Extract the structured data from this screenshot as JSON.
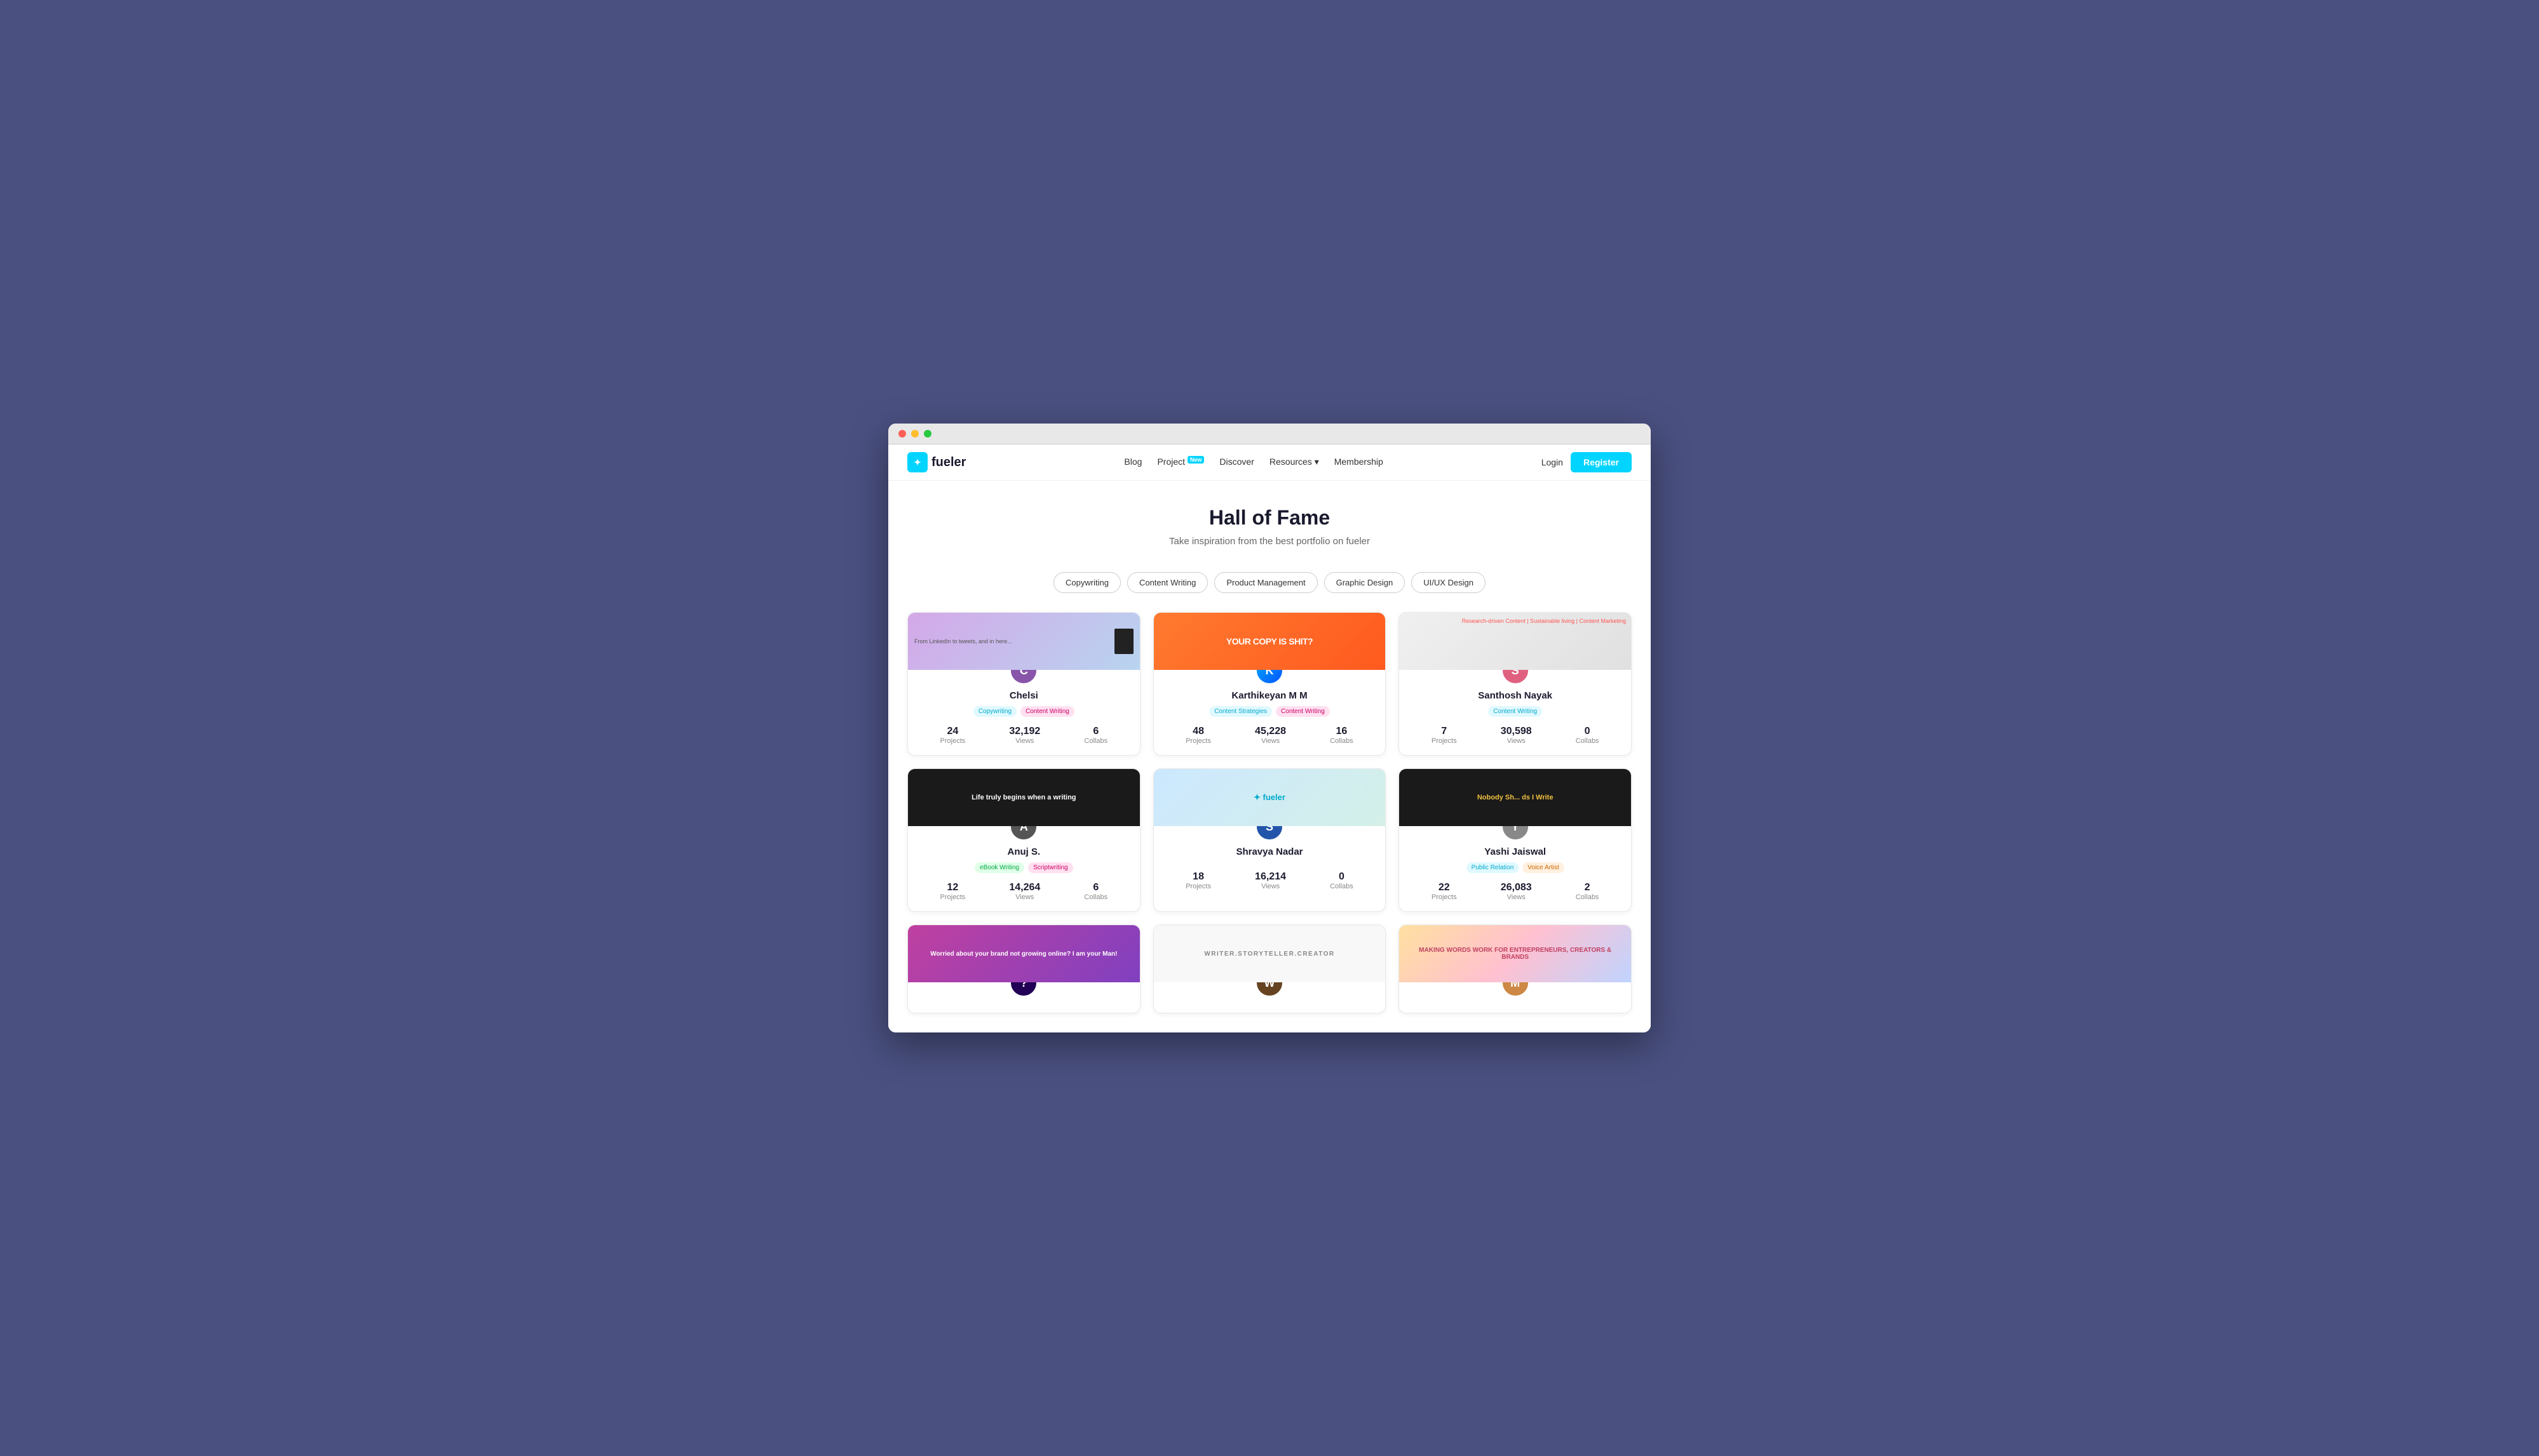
{
  "browser": {
    "dots": [
      "red",
      "yellow",
      "green"
    ]
  },
  "navbar": {
    "logo_text": "fueler",
    "links": [
      {
        "label": "Blog",
        "badge": null
      },
      {
        "label": "Project",
        "badge": "New"
      },
      {
        "label": "Discover",
        "badge": null
      },
      {
        "label": "Resources",
        "badge": null,
        "has_arrow": true
      },
      {
        "label": "Membership",
        "badge": null
      }
    ],
    "login_label": "Login",
    "register_label": "Register"
  },
  "hero": {
    "title": "Hall of Fame",
    "subtitle": "Take inspiration from the best portfolio on fueler"
  },
  "filters": [
    {
      "label": "Copywriting"
    },
    {
      "label": "Content Writing"
    },
    {
      "label": "Product Management"
    },
    {
      "label": "Graphic Design"
    },
    {
      "label": "UI/UX Design"
    }
  ],
  "cards": [
    {
      "name": "Chelsi",
      "banner_text": "From LinkedIn to tweets, and in here...",
      "banner_style": "chelsi",
      "avatar_color": "#8855aa",
      "avatar_letter": "C",
      "tags": [
        {
          "label": "Copywriting",
          "style": "cyan"
        },
        {
          "label": "Content Writing",
          "style": "pink"
        }
      ],
      "stats": [
        {
          "value": "24",
          "label": "Projects"
        },
        {
          "value": "32,192",
          "label": "Views"
        },
        {
          "value": "6",
          "label": "Collabs"
        }
      ]
    },
    {
      "name": "Karthikeyan M M",
      "banner_text": "YOUR COPY IS SHIT?",
      "banner_style": "karthik",
      "avatar_color": "#3388dd",
      "avatar_letter": "K",
      "tags": [
        {
          "label": "Content Strategies",
          "style": "cyan"
        },
        {
          "label": "Content Writing",
          "style": "pink"
        }
      ],
      "stats": [
        {
          "value": "48",
          "label": "Projects"
        },
        {
          "value": "45,228",
          "label": "Views"
        },
        {
          "value": "16",
          "label": "Collabs"
        }
      ]
    },
    {
      "name": "Santhosh Nayak",
      "banner_text": "Research-driven Content | Sustainable living | Content Marketing",
      "banner_style": "santhosh",
      "avatar_color": "#e06080",
      "avatar_letter": "S",
      "tags": [
        {
          "label": "Content Writing",
          "style": "cyan"
        }
      ],
      "stats": [
        {
          "value": "7",
          "label": "Projects"
        },
        {
          "value": "30,598",
          "label": "Views"
        },
        {
          "value": "0",
          "label": "Collabs"
        }
      ]
    },
    {
      "name": "Anuj S.",
      "banner_text": "Life truly begins when a writing",
      "banner_style": "anuj",
      "avatar_color": "#555",
      "avatar_letter": "A",
      "tags": [
        {
          "label": "eBook Writing",
          "style": "green"
        },
        {
          "label": "Scriptwriting",
          "style": "pink"
        }
      ],
      "stats": [
        {
          "value": "12",
          "label": "Projects"
        },
        {
          "value": "14,264",
          "label": "Views"
        },
        {
          "value": "6",
          "label": "Collabs"
        }
      ]
    },
    {
      "name": "Shravya Nadar",
      "banner_text": "fueler",
      "banner_style": "shravya",
      "avatar_color": "#2255aa",
      "avatar_letter": "S",
      "tags": [],
      "stats": [
        {
          "value": "18",
          "label": "Projects"
        },
        {
          "value": "16,214",
          "label": "Views"
        },
        {
          "value": "0",
          "label": "Collabs"
        }
      ]
    },
    {
      "name": "Yashi Jaiswal",
      "banner_text": "Nobody Sh... ds I Write",
      "banner_style": "yashi",
      "avatar_color": "#888",
      "avatar_letter": "Y",
      "tags": [
        {
          "label": "Public Relation",
          "style": "cyan"
        },
        {
          "label": "Voice Artist",
          "style": "orange"
        }
      ],
      "stats": [
        {
          "value": "22",
          "label": "Projects"
        },
        {
          "value": "26,083",
          "label": "Views"
        },
        {
          "value": "2",
          "label": "Collabs"
        }
      ]
    },
    {
      "name": "",
      "banner_text": "Worried about your brand not growing online? I am your Man!",
      "banner_style": "bottom1",
      "avatar_color": "#220055",
      "avatar_letter": "?",
      "tags": [],
      "stats": []
    },
    {
      "name": "",
      "banner_text": "WRITER.STORYTELLER.CREATOR",
      "banner_style": "bottom2",
      "avatar_color": "#664422",
      "avatar_letter": "W",
      "tags": [],
      "stats": []
    },
    {
      "name": "",
      "banner_text": "MAKING WORDS WORK FOR ENTREPRENEURS, CREATORS & BRANDS",
      "banner_style": "bottom3",
      "avatar_color": "#cc8844",
      "avatar_letter": "M",
      "tags": [],
      "stats": []
    }
  ]
}
